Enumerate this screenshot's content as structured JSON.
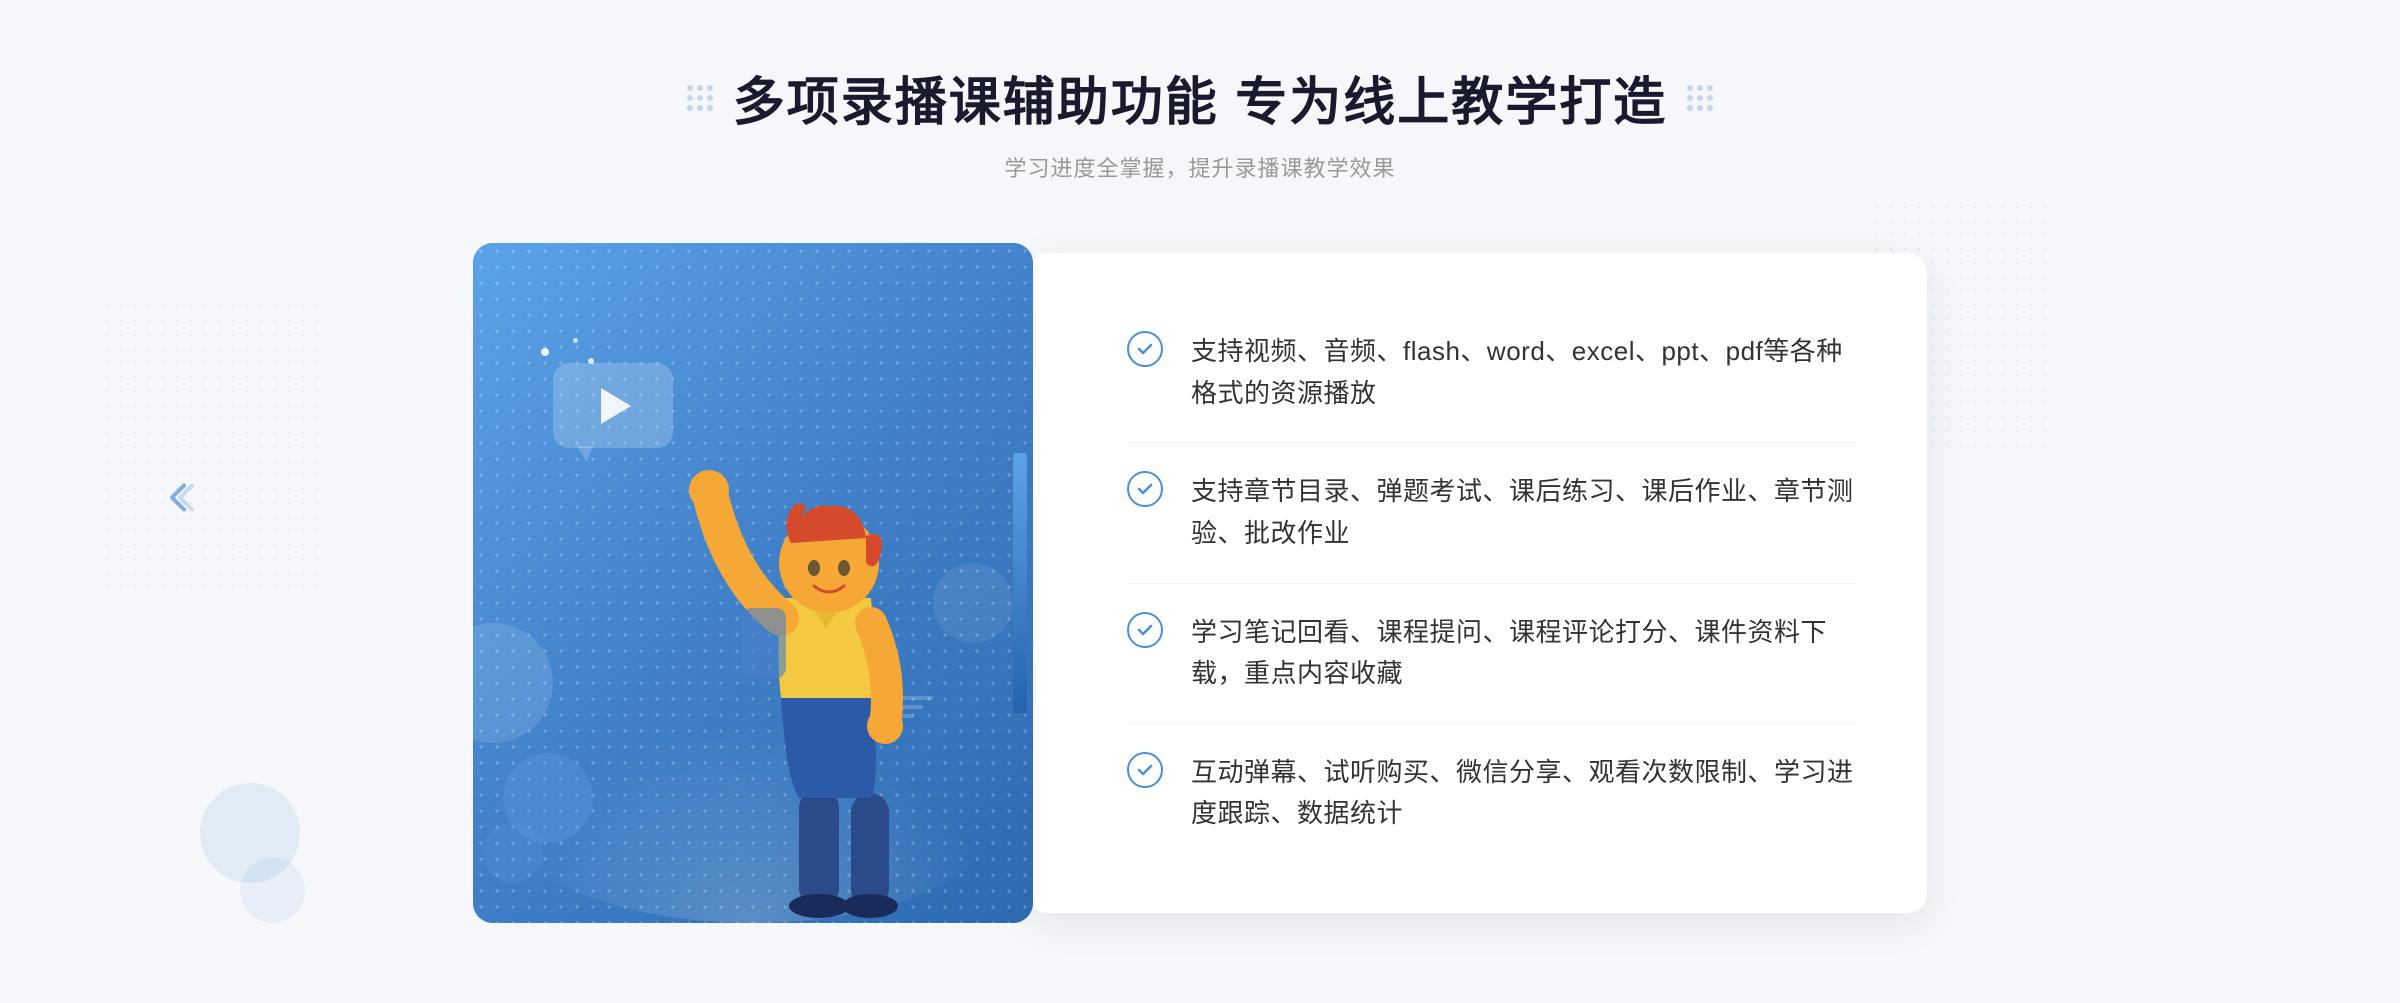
{
  "header": {
    "title": "多项录播课辅助功能 专为线上教学打造",
    "subtitle": "学习进度全掌握，提升录播课教学效果"
  },
  "features": [
    {
      "id": "feature-1",
      "text": "支持视频、音频、flash、word、excel、ppt、pdf等各种格式的资源播放"
    },
    {
      "id": "feature-2",
      "text": "支持章节目录、弹题考试、课后练习、课后作业、章节测验、批改作业"
    },
    {
      "id": "feature-3",
      "text": "学习笔记回看、课程提问、课程评论打分、课件资料下载，重点内容收藏"
    },
    {
      "id": "feature-4",
      "text": "互动弹幕、试听购买、微信分享、观看次数限制、学习进度跟踪、数据统计"
    }
  ],
  "colors": {
    "primary": "#4a90d9",
    "primary_dark": "#2563ae",
    "text_dark": "#1a1a2e",
    "text_gray": "#999999",
    "text_body": "#333333",
    "bg": "#f5f7fa",
    "white": "#ffffff"
  }
}
